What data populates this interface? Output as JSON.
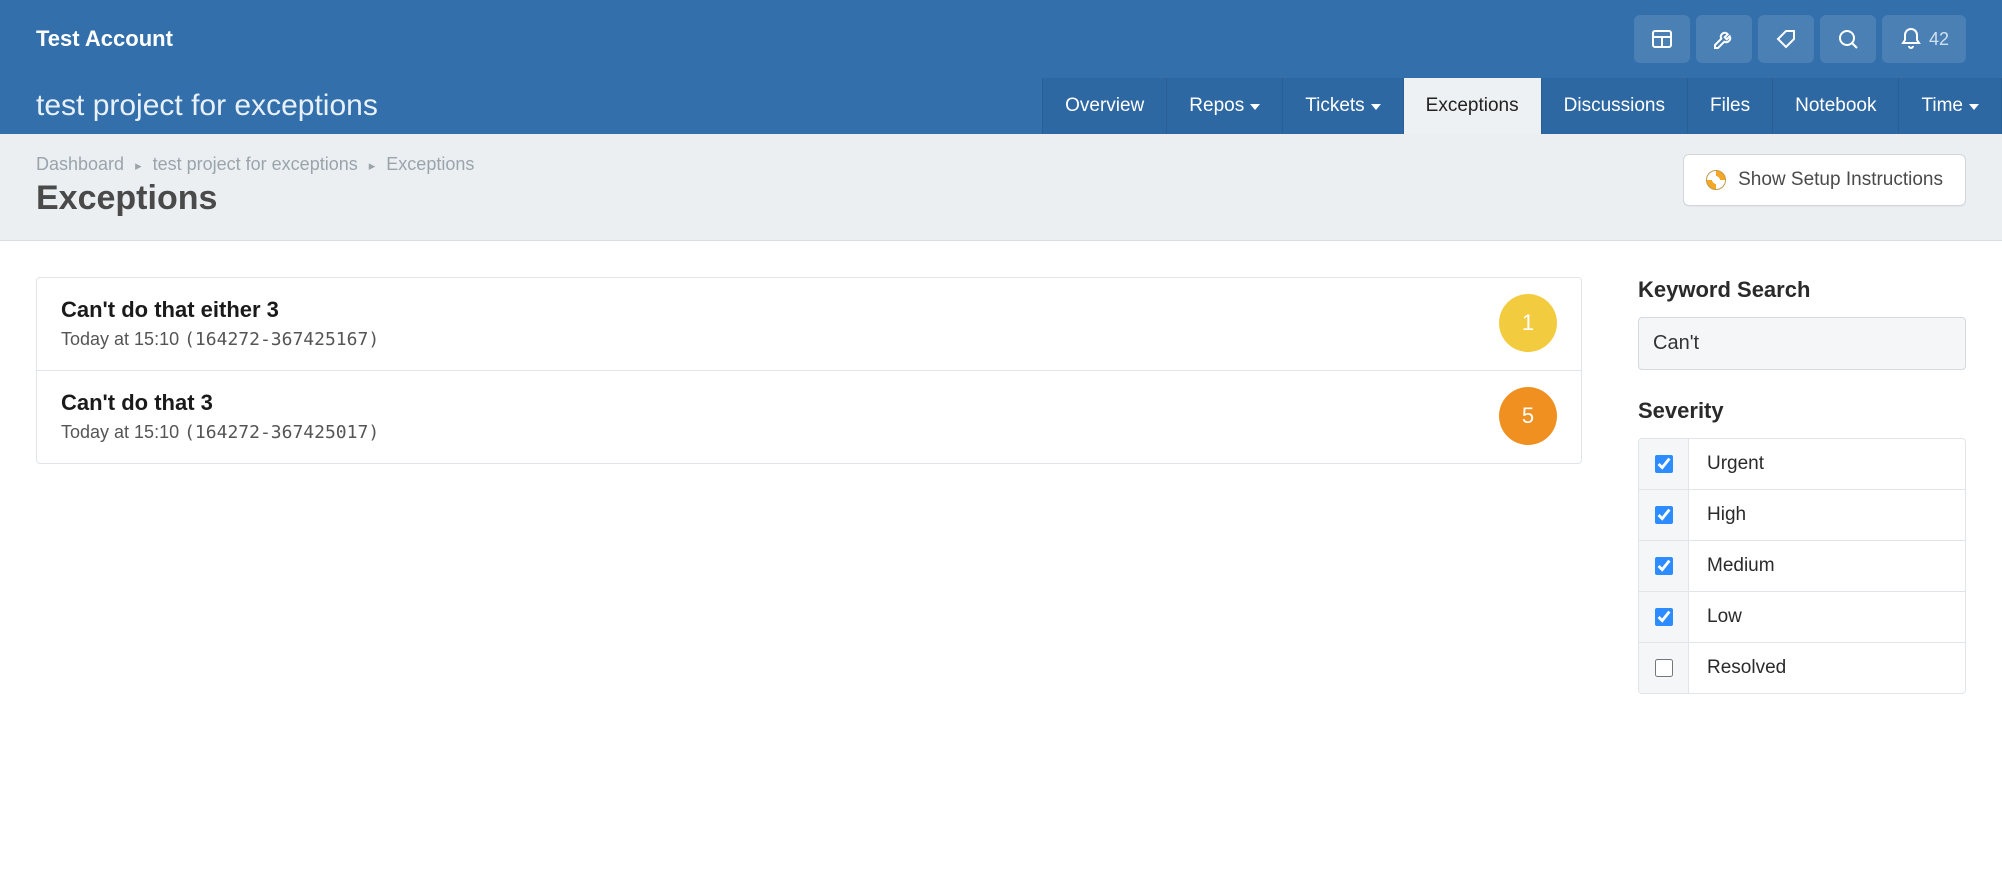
{
  "header": {
    "account_name": "Test Account",
    "notification_count": "42"
  },
  "project": {
    "title": "test project for exceptions"
  },
  "tabs": [
    {
      "label": "Overview",
      "dropdown": false,
      "active": false
    },
    {
      "label": "Repos",
      "dropdown": true,
      "active": false
    },
    {
      "label": "Tickets",
      "dropdown": true,
      "active": false
    },
    {
      "label": "Exceptions",
      "dropdown": false,
      "active": true
    },
    {
      "label": "Discussions",
      "dropdown": false,
      "active": false
    },
    {
      "label": "Files",
      "dropdown": false,
      "active": false
    },
    {
      "label": "Notebook",
      "dropdown": false,
      "active": false
    },
    {
      "label": "Time",
      "dropdown": true,
      "active": false
    }
  ],
  "breadcrumb": {
    "dashboard": "Dashboard",
    "project": "test project for exceptions",
    "current": "Exceptions"
  },
  "page_title": "Exceptions",
  "setup_button": "Show Setup Instructions",
  "exceptions": [
    {
      "title": "Can't do that either 3",
      "time": "Today at 15:10",
      "code": "(164272-367425167)",
      "count": "1",
      "color": "yellow"
    },
    {
      "title": "Can't do that 3",
      "time": "Today at 15:10",
      "code": "(164272-367425017)",
      "count": "5",
      "color": "orange"
    }
  ],
  "sidebar": {
    "search_label": "Keyword Search",
    "search_value": "Can't",
    "severity_label": "Severity",
    "severity": [
      {
        "label": "Urgent",
        "checked": true
      },
      {
        "label": "High",
        "checked": true
      },
      {
        "label": "Medium",
        "checked": true
      },
      {
        "label": "Low",
        "checked": true
      },
      {
        "label": "Resolved",
        "checked": false
      }
    ]
  }
}
